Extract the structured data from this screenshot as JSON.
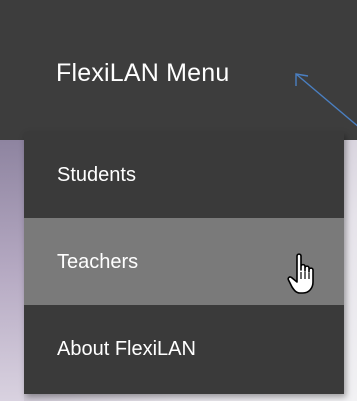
{
  "menu": {
    "title": "FlexiLAN Menu",
    "items": [
      {
        "label": "Students",
        "state": "normal"
      },
      {
        "label": "Teachers",
        "state": "hover"
      },
      {
        "label": "About FlexiLAN",
        "state": "normal"
      }
    ]
  },
  "colors": {
    "header_bg": "#3d3d3d",
    "menu_bg": "#3a3a3a",
    "hover_bg": "#7a7a7a",
    "text": "#ffffff",
    "annotation_arrow": "#4a7fc1"
  },
  "icons": {
    "pointer": "hand-pointer-icon",
    "annotation": "arrow-icon"
  }
}
